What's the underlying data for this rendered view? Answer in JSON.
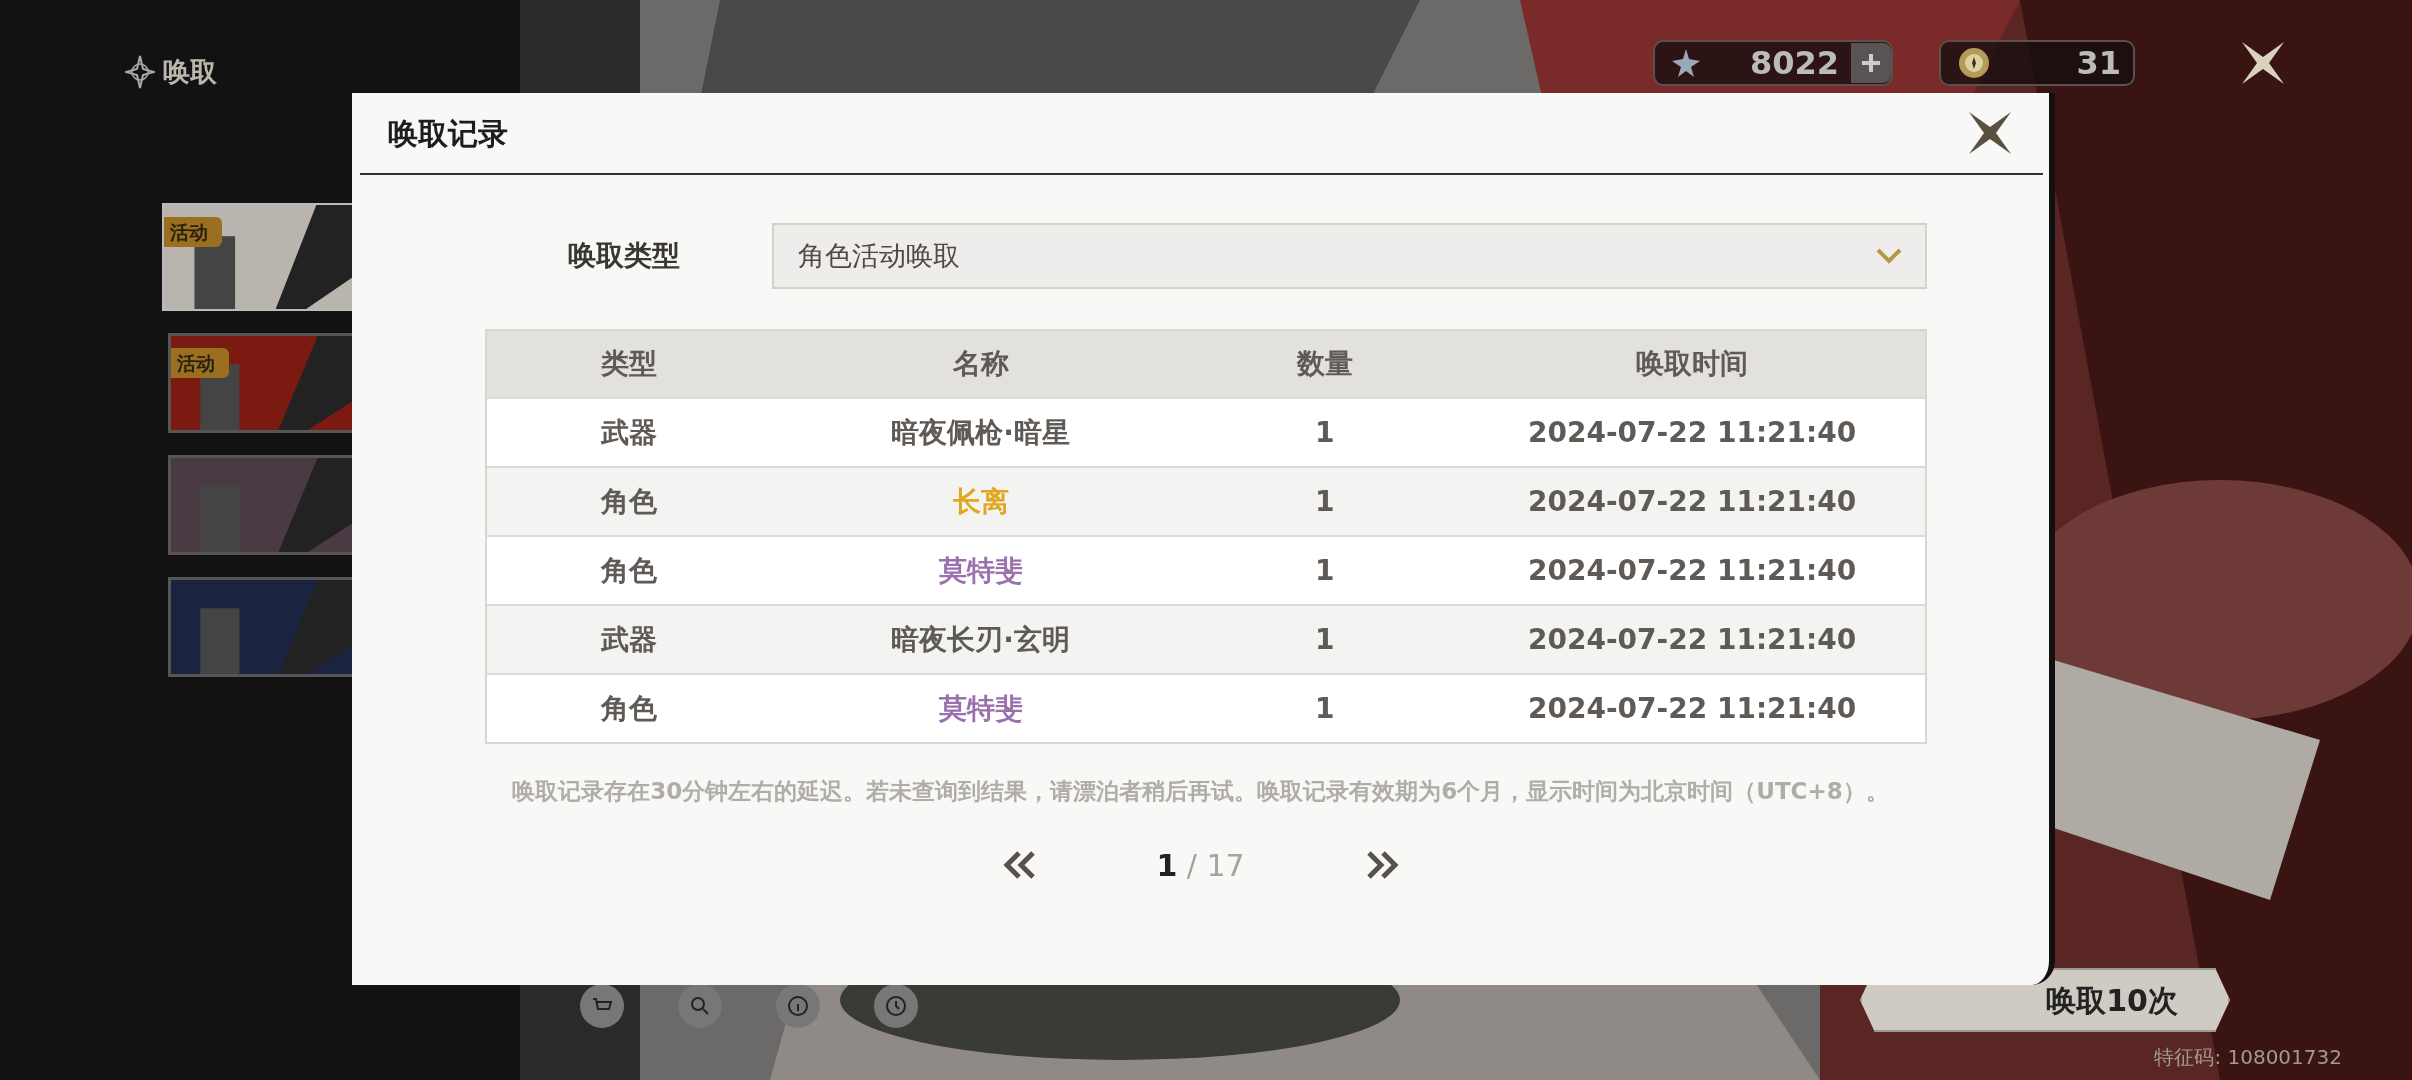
{
  "sidebar": {
    "title": "唤取",
    "banners": [
      {
        "badge": "活动",
        "selected": true
      },
      {
        "badge": "活动",
        "selected": false
      },
      {
        "selected": false
      },
      {
        "selected": false
      }
    ]
  },
  "currencies": [
    {
      "kind": "star",
      "amount": "8022",
      "addable": true
    },
    {
      "kind": "coin",
      "amount": "31",
      "addable": false
    }
  ],
  "dialog": {
    "title": "唤取记录",
    "filter": {
      "label": "唤取类型",
      "value": "角色活动唤取"
    },
    "table": {
      "columns": [
        "类型",
        "名称",
        "数量",
        "唤取时间"
      ],
      "rows": [
        {
          "type": "武器",
          "name": "暗夜佩枪·暗星",
          "count": "1",
          "time": "2024-07-22 11:21:40",
          "color": "#5f5a55"
        },
        {
          "type": "角色",
          "name": "长离",
          "count": "1",
          "time": "2024-07-22 11:21:40",
          "color": "#e0a820"
        },
        {
          "type": "角色",
          "name": "莫特斐",
          "count": "1",
          "time": "2024-07-22 11:21:40",
          "color": "#9a70ae"
        },
        {
          "type": "武器",
          "name": "暗夜长刃·玄明",
          "count": "1",
          "time": "2024-07-22 11:21:40",
          "color": "#5f5a55"
        },
        {
          "type": "角色",
          "name": "莫特斐",
          "count": "1",
          "time": "2024-07-22 11:21:40",
          "color": "#9a70ae"
        }
      ]
    },
    "note": "唤取记录存在30分钟左右的延迟。若未查询到结果，请漂泊者稍后再试。唤取记录有效期为6个月，显示时间为北京时间（UTC+8）。",
    "pager": {
      "current": "1",
      "total": "/ 17"
    }
  },
  "pull_button": "唤取10次",
  "player_id": "特征码: 108001732"
}
